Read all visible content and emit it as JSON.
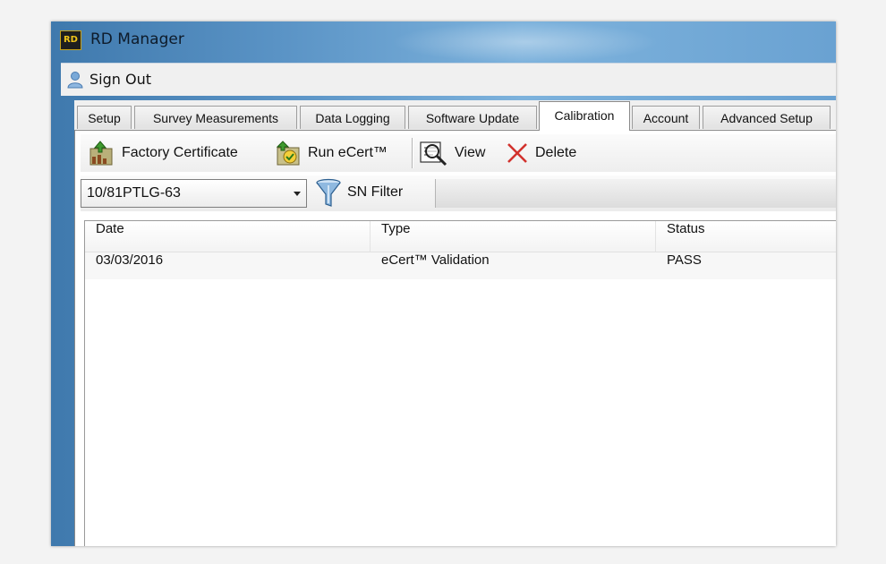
{
  "window": {
    "title": "RD Manager",
    "logo_text": "RD"
  },
  "menubar": {
    "signout_label": "Sign Out"
  },
  "tabs": [
    {
      "label": "Setup",
      "active": false
    },
    {
      "label": "Survey Measurements",
      "active": false
    },
    {
      "label": "Data Logging",
      "active": false
    },
    {
      "label": "Software Update",
      "active": false
    },
    {
      "label": "Calibration",
      "active": true
    },
    {
      "label": "Account",
      "active": false
    },
    {
      "label": "Advanced Setup",
      "active": false
    }
  ],
  "toolbar": {
    "factory_certificate": "Factory Certificate",
    "run_ecert": "Run eCert™",
    "view": "View",
    "delete": "Delete"
  },
  "filter": {
    "selected_serial": "10/81PTLG-63",
    "sn_filter_label": "SN Filter"
  },
  "table": {
    "columns": [
      "Date",
      "Type",
      "Status"
    ],
    "rows": [
      {
        "date": "03/03/2016",
        "type": "eCert™ Validation",
        "status": "PASS"
      }
    ]
  },
  "colors": {
    "title_gradient": "#5b94c6",
    "panel_bg": "#ffffff",
    "delete_x": "#d2322d"
  }
}
